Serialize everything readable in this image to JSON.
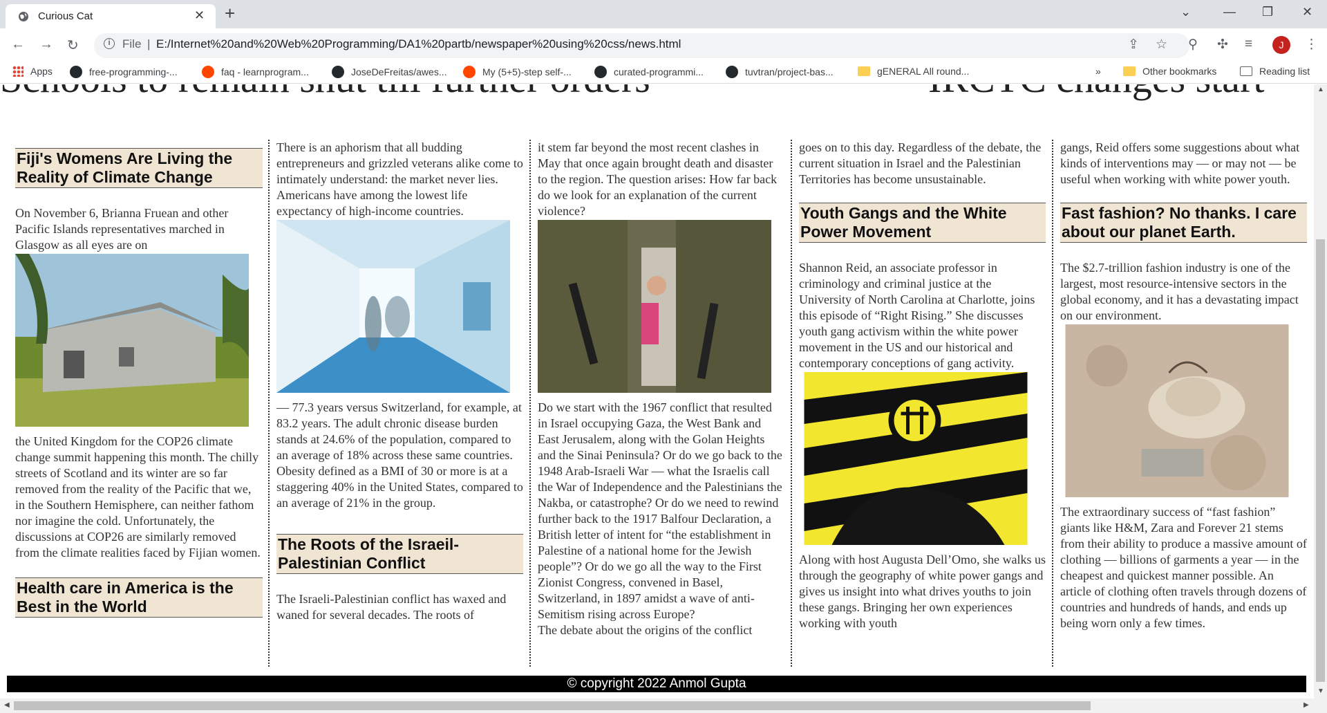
{
  "browser": {
    "tab_title": "Curious Cat",
    "url_scheme": "File",
    "url": "E:/Internet%20and%20Web%20Programming/DA1%20partb/newspaper%20using%20css/news.html",
    "avatar_letter": "J",
    "bookmarks": [
      "Apps",
      "free-programming-...",
      "faq - learnprogram...",
      "JoseDeFreitas/awes...",
      "My (5+5)-step self-...",
      "curated-programmi...",
      "tuvtran/project-bas...",
      "gENERAL All round...",
      "»",
      "Other bookmarks",
      "Reading list"
    ]
  },
  "page": {
    "top_headline_left": "Schools to remain shut till further orders",
    "top_headline_right": "IRCTC changes start",
    "col1": {
      "h1": "Fiji's Womens Are Living the Reality of Climate Change",
      "p1": "On November 6, Brianna Fruean and other Pacific Islands representatives marched in Glasgow as all eyes are on",
      "p2": "the United Kingdom for the COP26 climate change summit happening this month. The chilly streets of Scotland and its winter are so far removed from the reality of the Pacific that we, in the Southern Hemisphere, can neither fathom nor imagine the cold. Unfortunately, the discussions at COP26 are similarly removed from the climate realities faced by Fijian women.",
      "h2": "Health care in America is the Best in the World"
    },
    "col2": {
      "p1": "There is an aphorism that all budding entrepreneurs and grizzled veterans alike come to intimately understand: the market never lies. Americans have among the lowest life expectancy of high-income countries.",
      "p2": "— 77.3 years versus Switzerland, for example, at 83.2 years. The adult chronic disease burden stands at 24.6% of the population, compared to an average of 18% across these same countries. Obesity defined as a BMI of 30 or more is at a staggering 40% in the United States, compared to an average of 21% in the group.",
      "h1": "The Roots of the Israeil-Palestinian Conflict",
      "p3": "The Israeli-Palestinian conflict has waxed and waned for several decades. The roots of"
    },
    "col3": {
      "p1": "it stem far beyond the most recent clashes in May that once again brought death and disaster to the region. The question arises: How far back do we look for an explanation of the current violence?",
      "p2": "Do we start with the 1967 conflict that resulted in Israel occupying Gaza, the West Bank and East Jerusalem, along with the Golan Heights and the Sinai Peninsula? Or do we go back to the 1948 Arab-Israeli War — what the Israelis call the War of Independence and the Palestinians the Nakba, or catastrophe? Or do we need to rewind further back to the 1917 Balfour Declaration, a British letter of intent for “the establishment in Palestine of a national home for the Jewish people”? Or do we go all the way to the First Zionist Congress, convened in Basel, Switzerland, in 1897 amidst a wave of anti-Semitism rising across Europe?",
      "p3": "The debate about the origins of the conflict"
    },
    "col4": {
      "p1": "goes on to this day. Regardless of the debate, the current situation in Israel and the Palestinian Territories has become unsustainable.",
      "h1": "Youth Gangs and the White Power Movement",
      "p2": "Shannon Reid, an associate professor in criminology and criminal justice at the University of North Carolina at Charlotte, joins this episode of “Right Rising.” She discusses youth gang activism within the white power movement in the US and our historical and contemporary conceptions of gang activity.",
      "p3": "Along with host Augusta Dell’Omo, she walks us through the geography of white power gangs and gives us insight into what drives youths to join these gangs. Bringing her own experiences working with youth"
    },
    "col5": {
      "p1": "gangs, Reid offers some suggestions about what kinds of interventions may — or may not — be useful when working with white power youth.",
      "h1": "Fast fashion? No thanks. I care about our planet Earth.",
      "p2": "The $2.7-trillion fashion industry is one of the largest, most resource-intensive sectors in the global economy, and it has a devastating impact on our environment.",
      "p3": "The extraordinary success of “fast fashion” giants like H&M, Zara and Forever 21 stems from their ability to produce a massive amount of clothing — billions of garments a year — in the cheapest and quickest manner possible. An article of clothing often travels through dozens of countries and hundreds of hands, and ends up being worn only a few times."
    },
    "footer": "© copyright 2022 Anmol Gupta"
  }
}
